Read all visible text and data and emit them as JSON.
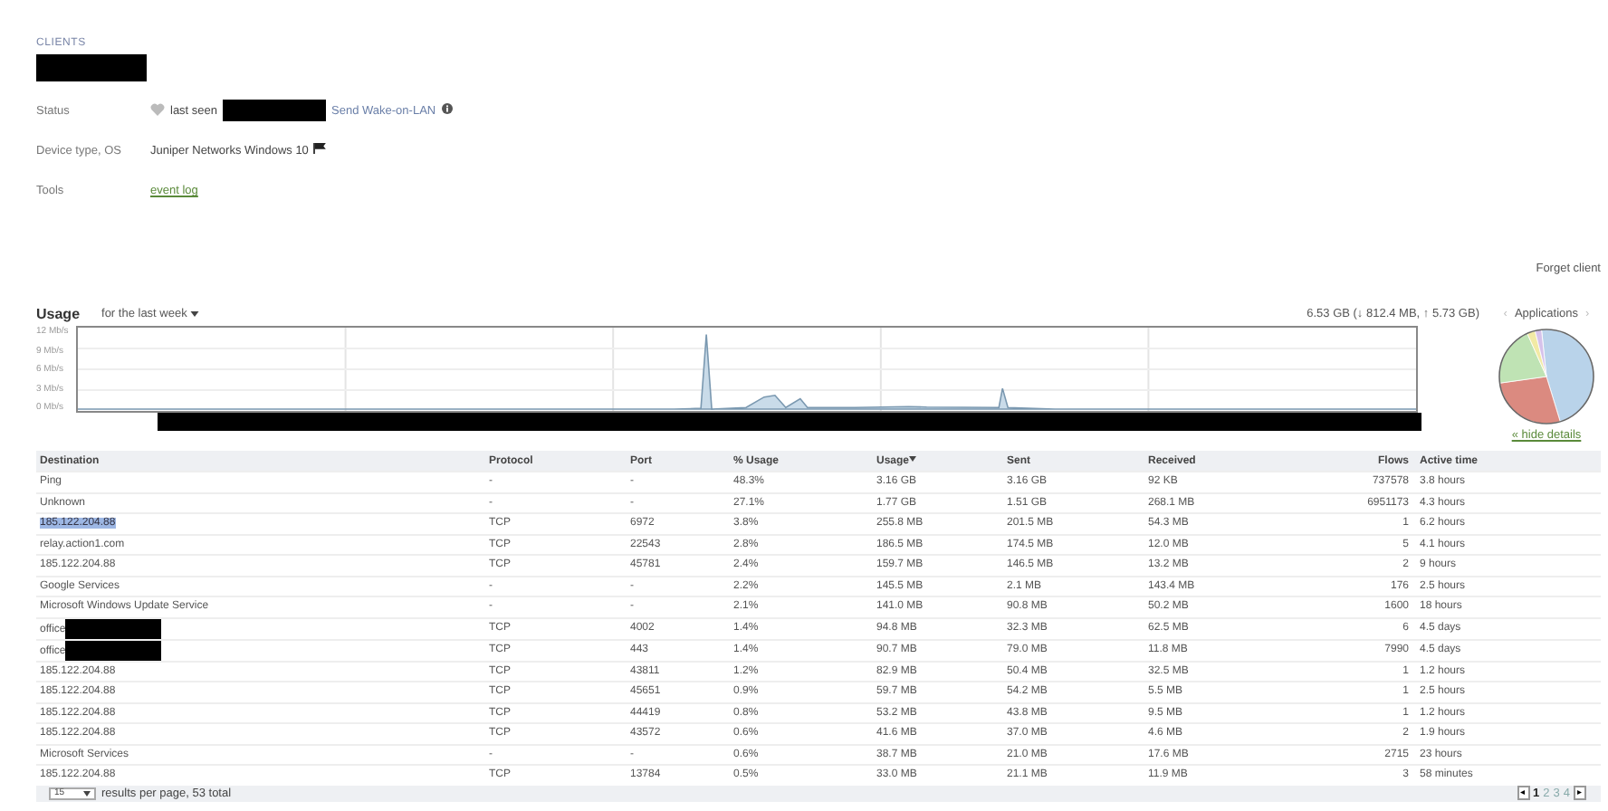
{
  "breadcrumb": "CLIENTS",
  "client_name_redacted": true,
  "details": [
    {
      "kind": "status",
      "label": "Status",
      "online": false,
      "text": "last seen",
      "redacted": true,
      "link": "Send Wake-on-LAN"
    },
    {
      "kind": "device",
      "label": "Device type, OS",
      "text": "Juniper Networks Windows 10"
    },
    {
      "kind": "tools",
      "label": "Tools",
      "link": "event log"
    }
  ],
  "forget_button": "Forget client",
  "usage": {
    "title": "Usage",
    "range": "for the last week",
    "total": "6.53 GB (↓ 812.4 MB, ↑ 5.73 GB)",
    "y_labels": [
      "12 Mb/s",
      "9 Mb/s",
      "6 Mb/s",
      "3 Mb/s",
      "0 Mb/s"
    ],
    "x_labels_redacted": true,
    "pie_title": "Applications",
    "prev": "‹",
    "next": "›",
    "hide_link": "« hide details"
  },
  "table": {
    "columns": [
      {
        "label": "Destination",
        "sorted": false
      },
      {
        "label": "Protocol",
        "sorted": false
      },
      {
        "label": "Port",
        "sorted": false
      },
      {
        "label": "% Usage",
        "sorted": false
      },
      {
        "label": "Usage",
        "sorted": true
      },
      {
        "label": "Sent",
        "sorted": false
      },
      {
        "label": "Received",
        "sorted": false
      },
      {
        "label": "Flows",
        "sorted": false
      },
      {
        "label": "Active time",
        "sorted": false
      }
    ],
    "rows": [
      {
        "cells": [
          "Ping",
          "-",
          "-",
          "48.3%",
          "3.16 GB",
          "3.16 GB",
          "92 KB",
          "737578",
          "3.8 hours"
        ],
        "redacted": false,
        "highlighted": false
      },
      {
        "cells": [
          "Unknown",
          "-",
          "-",
          "27.1%",
          "1.77 GB",
          "1.51 GB",
          "268.1 MB",
          "6951173",
          "4.3 hours"
        ],
        "redacted": false,
        "highlighted": false
      },
      {
        "cells": [
          "185.122.204.88",
          "TCP",
          "6972",
          "3.8%",
          "255.8 MB",
          "201.5 MB",
          "54.3 MB",
          "1",
          "6.2 hours"
        ],
        "redacted": false,
        "highlighted": true
      },
      {
        "cells": [
          "relay.action1.com",
          "TCP",
          "22543",
          "2.8%",
          "186.5 MB",
          "174.5 MB",
          "12.0 MB",
          "5",
          "4.1 hours"
        ],
        "redacted": false,
        "highlighted": false
      },
      {
        "cells": [
          "185.122.204.88",
          "TCP",
          "45781",
          "2.4%",
          "159.7 MB",
          "146.5 MB",
          "13.2 MB",
          "2",
          "9 hours"
        ],
        "redacted": false,
        "highlighted": false
      },
      {
        "cells": [
          "Google Services",
          "-",
          "-",
          "2.2%",
          "145.5 MB",
          "2.1 MB",
          "143.4 MB",
          "176",
          "2.5 hours"
        ],
        "redacted": false,
        "highlighted": false
      },
      {
        "cells": [
          "Microsoft Windows Update Service",
          "-",
          "-",
          "2.1%",
          "141.0 MB",
          "90.8 MB",
          "50.2 MB",
          "1600",
          "18 hours"
        ],
        "redacted": false,
        "highlighted": false
      },
      {
        "cells": [
          "office",
          "TCP",
          "4002",
          "1.4%",
          "94.8 MB",
          "32.3 MB",
          "62.5 MB",
          "6",
          "4.5 days"
        ],
        "redacted": true,
        "highlighted": false
      },
      {
        "cells": [
          "office",
          "TCP",
          "443",
          "1.4%",
          "90.7 MB",
          "79.0 MB",
          "11.8 MB",
          "7990",
          "4.5 days"
        ],
        "redacted": true,
        "highlighted": false
      },
      {
        "cells": [
          "185.122.204.88",
          "TCP",
          "43811",
          "1.2%",
          "82.9 MB",
          "50.4 MB",
          "32.5 MB",
          "1",
          "1.2 hours"
        ],
        "redacted": false,
        "highlighted": false
      },
      {
        "cells": [
          "185.122.204.88",
          "TCP",
          "45651",
          "0.9%",
          "59.7 MB",
          "54.2 MB",
          "5.5 MB",
          "1",
          "2.5 hours"
        ],
        "redacted": false,
        "highlighted": false
      },
      {
        "cells": [
          "185.122.204.88",
          "TCP",
          "44419",
          "0.8%",
          "53.2 MB",
          "43.8 MB",
          "9.5 MB",
          "1",
          "1.2 hours"
        ],
        "redacted": false,
        "highlighted": false
      },
      {
        "cells": [
          "185.122.204.88",
          "TCP",
          "43572",
          "0.6%",
          "41.6 MB",
          "37.0 MB",
          "4.6 MB",
          "2",
          "1.9 hours"
        ],
        "redacted": false,
        "highlighted": false
      },
      {
        "cells": [
          "Microsoft Services",
          "-",
          "-",
          "0.6%",
          "38.7 MB",
          "21.0 MB",
          "17.6 MB",
          "2715",
          "23 hours"
        ],
        "redacted": false,
        "highlighted": false
      },
      {
        "cells": [
          "185.122.204.88",
          "TCP",
          "13784",
          "0.5%",
          "33.0 MB",
          "21.1 MB",
          "11.9 MB",
          "3",
          "58 minutes"
        ],
        "redacted": false,
        "highlighted": false
      }
    ]
  },
  "footer": {
    "page_size": "15",
    "summary": "results per page, 53 total",
    "prev": "◂",
    "next": "▸",
    "pages": [
      {
        "label": "1",
        "selected": true
      },
      {
        "label": "2",
        "selected": false
      },
      {
        "label": "3",
        "selected": false
      },
      {
        "label": "4",
        "selected": false
      }
    ]
  }
}
